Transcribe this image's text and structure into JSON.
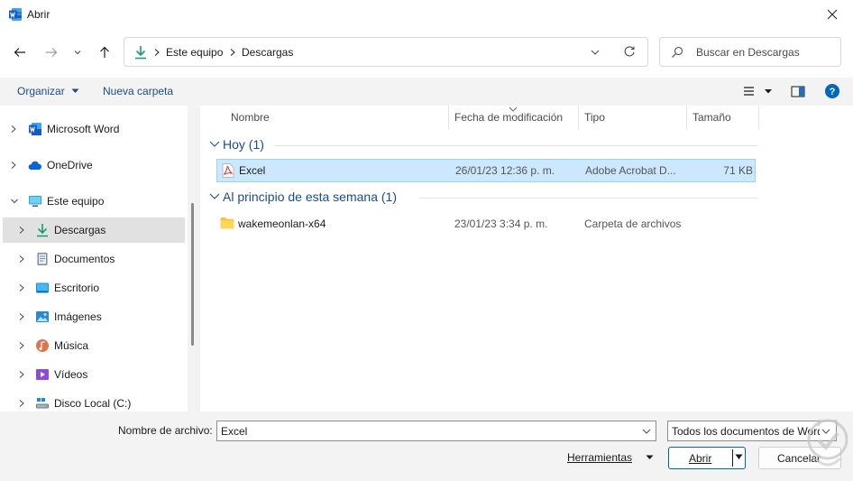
{
  "window": {
    "title": "Abrir"
  },
  "address": {
    "crumbs": [
      "Este equipo",
      "Descargas"
    ]
  },
  "search": {
    "placeholder": "Buscar en Descargas"
  },
  "toolbar": {
    "organize": "Organizar",
    "new_folder": "Nueva carpeta"
  },
  "nav": {
    "items": [
      {
        "label": "Microsoft Word",
        "icon": "word-icon"
      },
      {
        "label": "OneDrive",
        "icon": "onedrive-icon"
      },
      {
        "label": "Este equipo",
        "icon": "computer-icon"
      },
      {
        "label": "Descargas",
        "icon": "download-icon"
      },
      {
        "label": "Documentos",
        "icon": "documents-icon"
      },
      {
        "label": "Escritorio",
        "icon": "desktop-icon"
      },
      {
        "label": "Imágenes",
        "icon": "pictures-icon"
      },
      {
        "label": "Música",
        "icon": "music-icon"
      },
      {
        "label": "Vídeos",
        "icon": "videos-icon"
      },
      {
        "label": "Disco Local (C:)",
        "icon": "drive-icon"
      }
    ]
  },
  "columns": {
    "name": "Nombre",
    "modified": "Fecha de modificación",
    "type": "Tipo",
    "size": "Tamaño"
  },
  "groups": [
    {
      "label": "Hoy (1)",
      "files": [
        {
          "name": "Excel",
          "date": "26/01/23 12:36 p. m.",
          "type": "Adobe Acrobat D...",
          "size": "71 KB",
          "icon": "pdf-icon"
        }
      ]
    },
    {
      "label": "Al principio de esta semana (1)",
      "files": [
        {
          "name": "wakemeonlan-x64",
          "date": "23/01/23 3:34 p. m.",
          "type": "Carpeta de archivos",
          "size": "",
          "icon": "folder-icon"
        }
      ]
    }
  ],
  "footer": {
    "filename_label": "Nombre de archivo:",
    "filename_value": "Excel",
    "filetype_value": "Todos los documentos de Word",
    "tools_label": "Herramientas",
    "open_label": "Abrir",
    "cancel_label": "Cancelar"
  },
  "colors": {
    "accent": "#005fb8",
    "selection": "#cce8ff",
    "group": "#1a4c8a"
  }
}
